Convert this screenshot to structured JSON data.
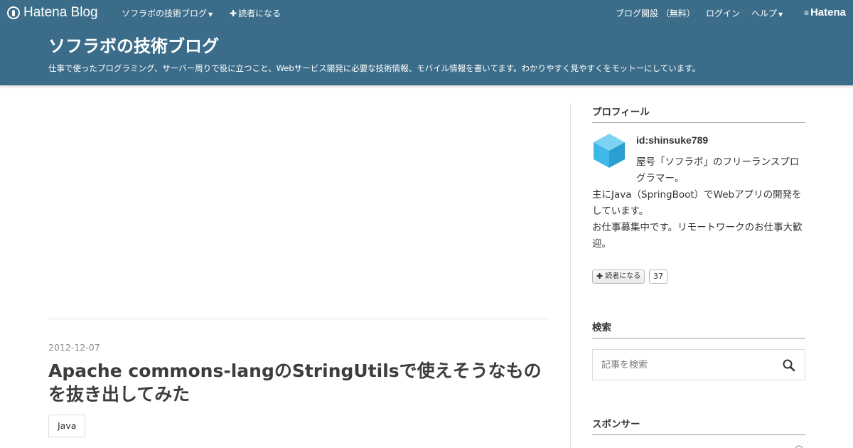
{
  "topbar": {
    "brand_label": "Hatena Blog",
    "nav_blog": "ソフラボの技術ブログ",
    "nav_subscribe": "読者になる",
    "nav_open": "ブログ開設 （無料）",
    "nav_login": "ログイン",
    "nav_help": "ヘルプ",
    "hatena_label": "Hatena"
  },
  "header": {
    "title": "ソフラボの技術ブログ",
    "description": "仕事で使ったプログラミング、サーバー周りで役に立つこと、Webサービス開発に必要な技術情報、モバイル情報を書いてます。わかりやすく見やすくをモットーにしています。"
  },
  "post": {
    "date": "2012-12-07",
    "title": "Apache commons-langのStringUtilsで使えそうなものを抜き出してみた",
    "category": "Java"
  },
  "sidebar": {
    "profile": {
      "heading": "プロフィール",
      "user_id": "id:shinsuke789",
      "intro_line1": "屋号「ソフラボ」のフリーランスプログラマー。",
      "intro_line2": "主にJava（SpringBoot）でWebアプリの開発をしています。",
      "intro_line3": "お仕事募集中です。リモートワークのお仕事大歓迎。",
      "subscribe_label": "読者になる",
      "reader_count": "37"
    },
    "search": {
      "heading": "検索",
      "placeholder": "記事を検索"
    },
    "sponsor": {
      "heading": "スポンサー"
    }
  },
  "colors": {
    "header_bg": "#3b6d8a",
    "avatar_blue": "#3db8e8"
  }
}
